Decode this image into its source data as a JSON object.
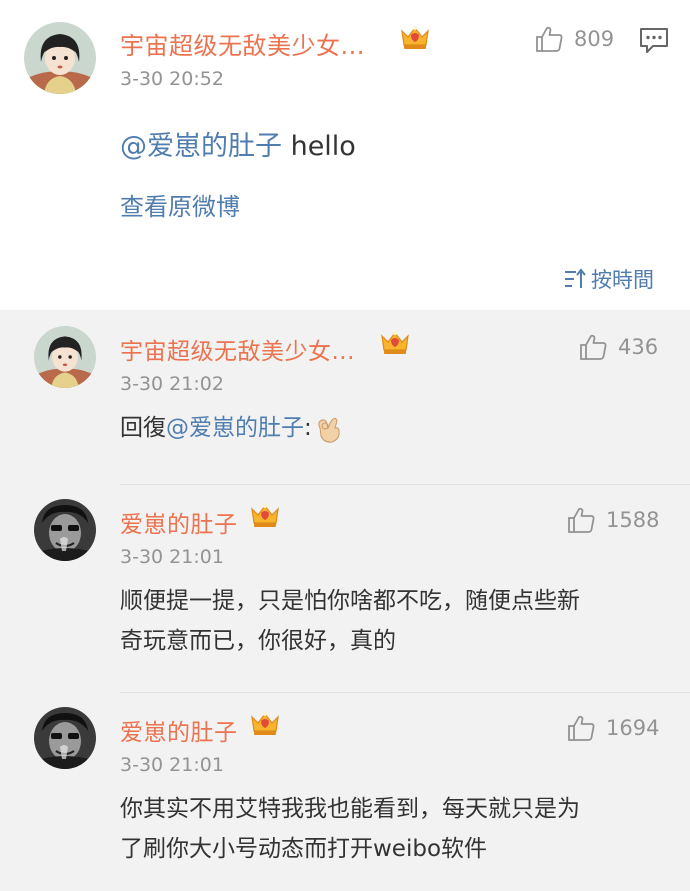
{
  "main_comment": {
    "username": "宇宙超级无敌美少女...",
    "time": "3-30 20:52",
    "likes": "809",
    "mention": "@爱崽的肚子",
    "text": " hello",
    "view_original": "查看原微博"
  },
  "sort": {
    "label": "按時間"
  },
  "replies": [
    {
      "username": "宇宙超级无敌美少女...",
      "time": "3-30 21:02",
      "likes": "436",
      "prefix": "回復",
      "mention": "@爱崽的肚子",
      "suffix": ":",
      "emoji": "ok-hand"
    },
    {
      "username": "爱崽的肚子",
      "time": "3-30 21:01",
      "likes": "1588",
      "line1": "顺便提一提，只是怕你啥都不吃，随便点些新",
      "line2": "奇玩意而已，你很好，真的"
    },
    {
      "username": "爱崽的肚子",
      "time": "3-30 21:01",
      "likes": "1694",
      "line1": "你其实不用艾特我我也能看到，每天就只是为",
      "line2": "了刷你大小号动态而打开weibo软件"
    }
  ],
  "colors": {
    "username": "#eb7350",
    "link": "#507daf",
    "meta": "#939393",
    "text": "#333333",
    "reply_bg": "#f2f2f2"
  }
}
